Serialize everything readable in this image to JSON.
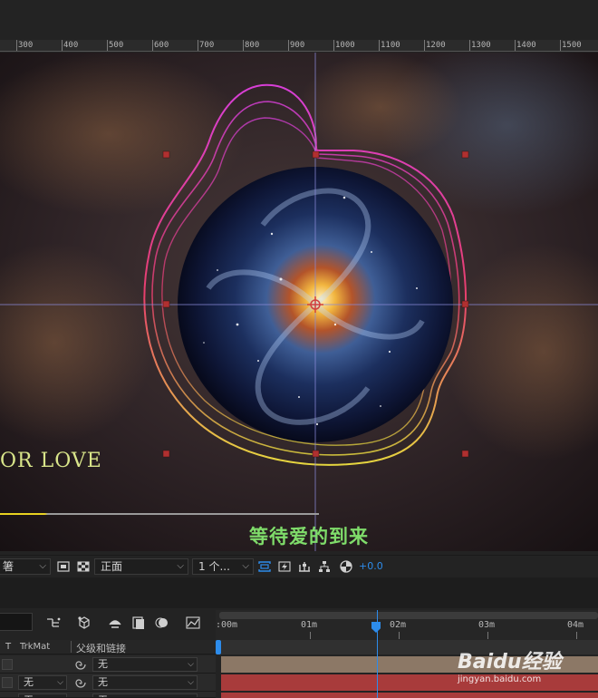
{
  "ruler": {
    "labels": [
      "300",
      "400",
      "500",
      "600",
      "700",
      "800",
      "900",
      "1000",
      "1100",
      "1200",
      "1300",
      "1400",
      "1500"
    ]
  },
  "viewer": {
    "love_text": "OR LOVE",
    "subtitle": "等待爱的到来"
  },
  "viewer_toolbar": {
    "channel_select": "箸",
    "view_select": "正面",
    "views_count_select": "1 个...",
    "exposure_value": "+0.0"
  },
  "timeline": {
    "time_labels": [
      ":00m",
      "01m",
      "02m",
      "03m",
      "04m"
    ],
    "columns": {
      "t": "T",
      "trkmat": "TrkMat",
      "parent": "父级和链接"
    },
    "rows": [
      {
        "trkmat": "",
        "parent": "无",
        "track_color": "#8c7866"
      },
      {
        "trkmat": "无",
        "parent": "无",
        "track_color": "#a83b3b"
      },
      {
        "trkmat": "无",
        "parent": "无",
        "track_color": "#a83b3b"
      }
    ]
  },
  "watermark": {
    "logo": "Baidu经验",
    "url": "jingyan.baidu.com"
  },
  "colors": {
    "accent_blue": "#2d8ceb",
    "subtitle_green": "#7fdc6a",
    "love_yellow": "#d9e58a",
    "handle_red": "#b03030"
  }
}
